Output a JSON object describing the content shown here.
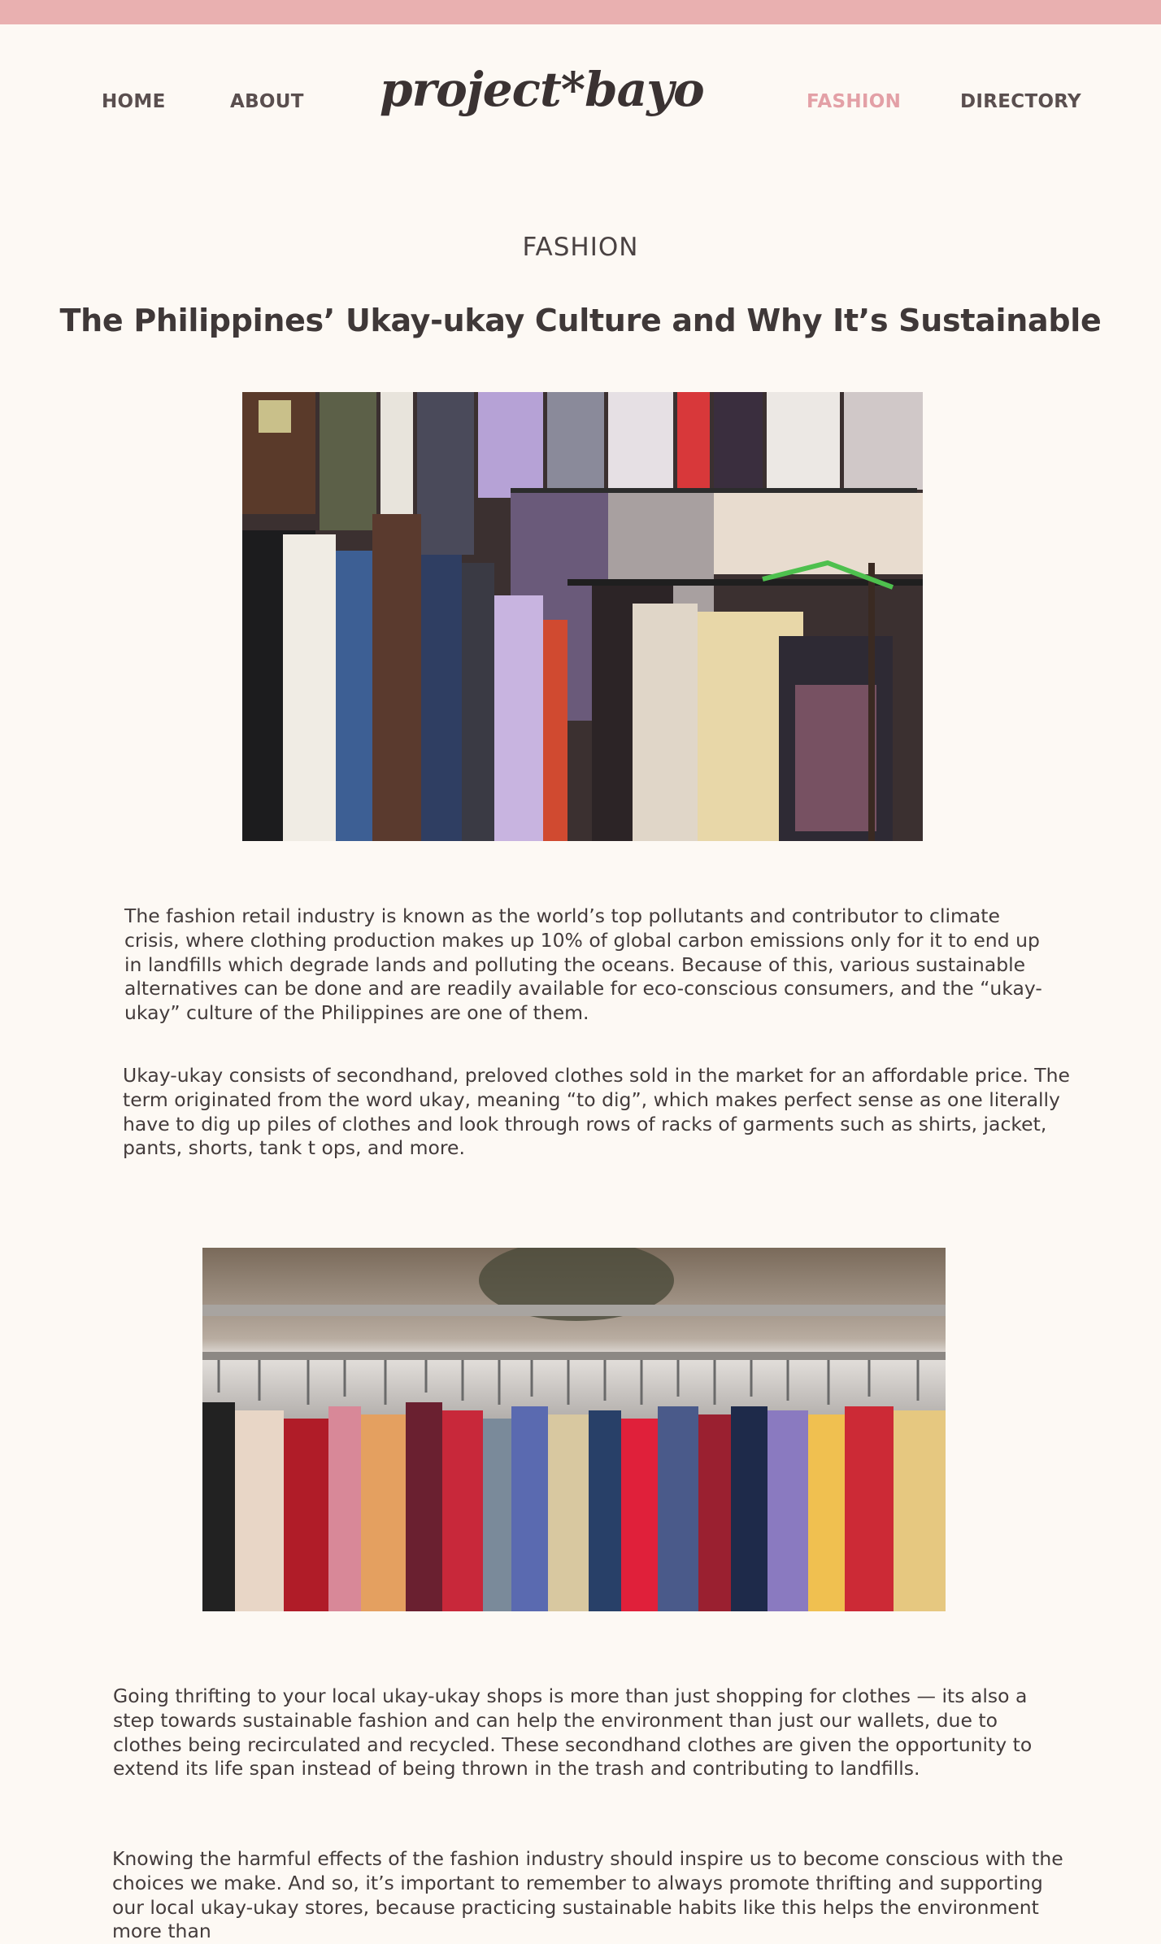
{
  "nav": {
    "home": "HOME",
    "about": "ABOUT",
    "logo_text": "project*bayo",
    "fashion": "FASHION",
    "directory": "DIRECTORY"
  },
  "article": {
    "section": "FASHION",
    "title": "The Philippines’ Ukay-ukay Culture and Why It’s Sustainable",
    "paragraphs": [
      "The fashion retail industry is known as the world’s top pollutants and contributor to climate crisis, where clothing production makes up 10% of global carbon emissions only for it to end up in landfills which degrade lands and polluting the oceans. Because of this, various sustainable alternatives can be done and are readily available for eco-conscious consumers, and the “ukay-ukay” culture of the Philippines are one of them.",
      "Ukay-ukay consists of secondhand, preloved clothes sold in the market for an affordable price. The term originated from the word ukay, meaning “to dig”, which makes perfect sense as one literally have to dig up piles of clothes and look through rows of racks of garments such as shirts, jacket, pants, shorts, tank t ops, and more.",
      "Going thrifting to your local ukay-ukay shops is  more than just shopping for clothes — its also a step towards sustainable fashion and can help the environment than just our wallets, due to clothes being recirculated and recycled. These secondhand clothes are given the opportunity to extend its life span instead of being  thrown in the trash and contributing to landfills.",
      "Knowing the harmful effects of the fashion industry should inspire us to become conscious with the choices we make. And so, it’s important to remember to always promote thrifting and supporting our local ukay-ukay stores, because practicing sustainable habits like this helps the environment more than"
    ]
  },
  "colors": {
    "accent": "#e9b0b0",
    "active_nav": "#e3a0a6",
    "background": "#fdf9f4",
    "text": "#433b3b"
  }
}
